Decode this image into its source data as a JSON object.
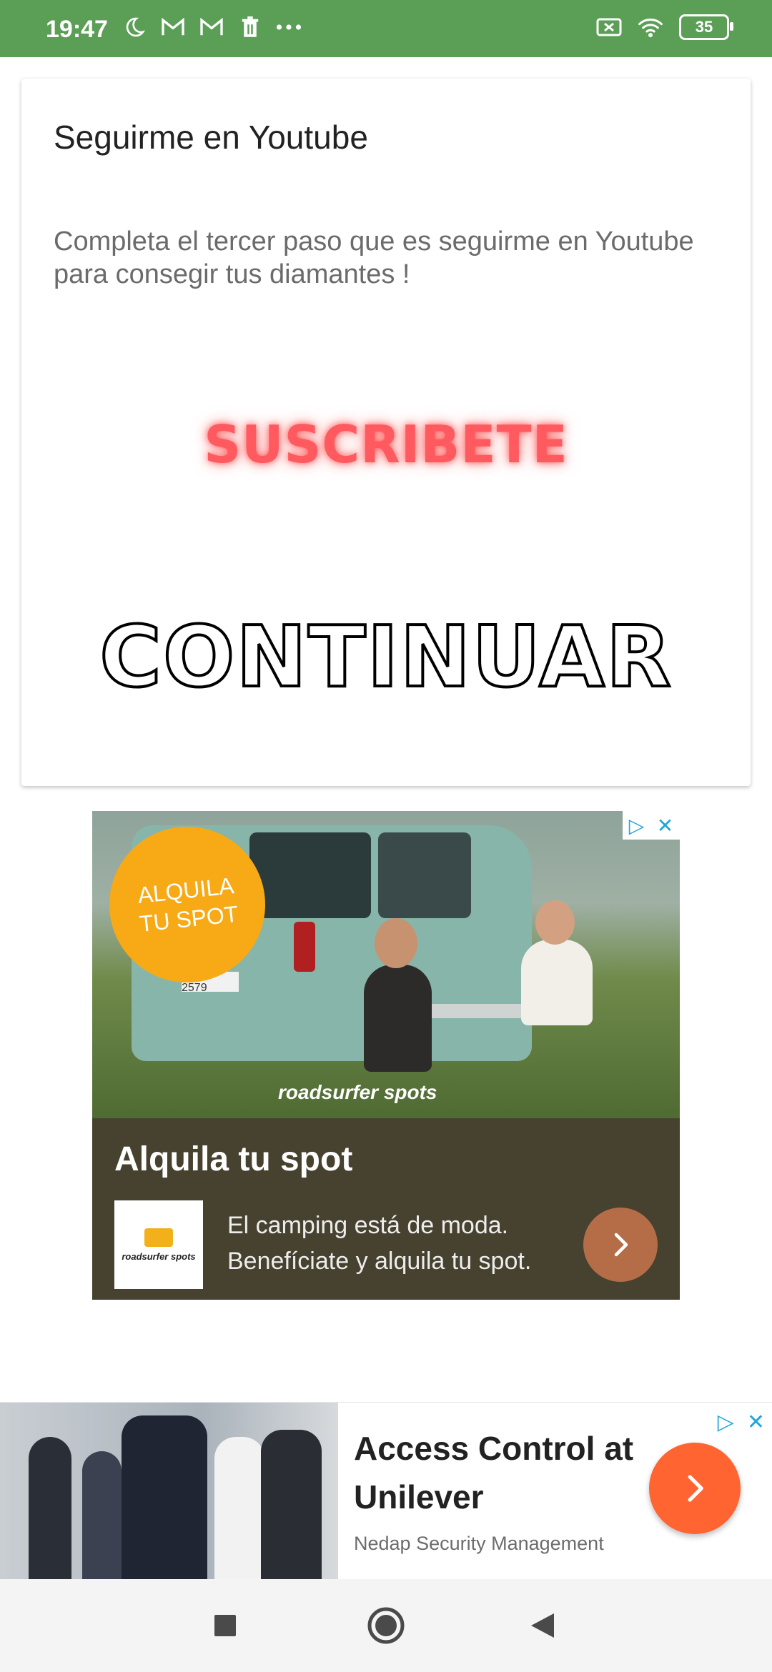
{
  "status_bar": {
    "time": "19:47",
    "battery": "35",
    "icons_left": [
      "moon-icon",
      "gmail-icon",
      "gmail-icon",
      "trash-icon",
      "more-dots-icon"
    ],
    "icons_right": [
      "no-sim-icon",
      "wifi-icon",
      "battery-icon"
    ],
    "color": "#5b9e56"
  },
  "card": {
    "title": "Seguirme en Youtube",
    "description": "Completa el tercer paso que es seguirme en Youtube para consegir tus diamantes !",
    "subscribe_label": "SUSCRIBETE",
    "continue_label": "CONTINUAR"
  },
  "ad1": {
    "badge_line1": "ALQUILA",
    "badge_line2": "TU SPOT",
    "plate": "AT-RS 2579",
    "brand_overlay": "roadsurfer spots",
    "headline": "Alquila tu spot",
    "body": "El camping está de moda. Benefíciate y alquila tu spot.",
    "logo_text": "roadsurfer spots"
  },
  "ad2": {
    "title": "Access Control at Unilever",
    "subtitle": "Nedap Security Management"
  },
  "nav": {
    "buttons": [
      "recents-button",
      "home-button",
      "back-button"
    ]
  }
}
